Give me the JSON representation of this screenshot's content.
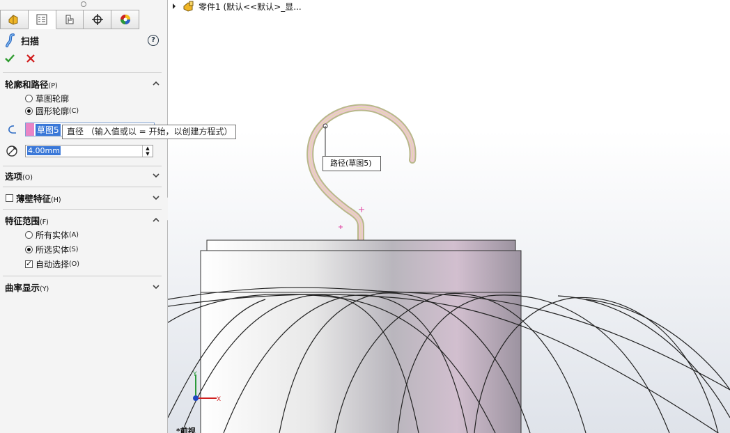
{
  "tabs": [
    {
      "name": "feature-manager-tab"
    },
    {
      "name": "property-manager-tab",
      "active": true
    },
    {
      "name": "configuration-manager-tab"
    },
    {
      "name": "dimxpert-tab"
    },
    {
      "name": "display-manager-tab"
    }
  ],
  "feature": {
    "title": "扫描",
    "help": "?"
  },
  "sections": {
    "profile_path": {
      "title": "轮廓和路径",
      "key": "(P)"
    },
    "options": {
      "title": "选项",
      "key": "(O)"
    },
    "thin": {
      "title": "薄壁特征",
      "key": "(H)"
    },
    "scope": {
      "title": "特征范围",
      "key": "(F)"
    },
    "curvature": {
      "title": "曲率显示",
      "key": "(Y)"
    }
  },
  "profile_options": {
    "sketch": "草图轮廓",
    "circle": "圆形轮廓",
    "circle_key": "(C)"
  },
  "path_selection": "草图5",
  "tooltip": "直径 （输入值或以 = 开始，以创建方程式）",
  "diameter_value": "4.00mm",
  "scope_options": {
    "all": "所有实体",
    "all_key": "(A)",
    "selected": "所选实体",
    "selected_key": "(S)",
    "auto": "自动选择",
    "auto_key": "(O)"
  },
  "tree_label": "零件1 (默认<<默认>_显...",
  "path_callout": "路径(草图5)",
  "axes": {
    "x": "X",
    "y": "Y"
  },
  "bottom_label": "*前视",
  "colors": {
    "accent": "#3a78d8",
    "ok": "#2f9b2f",
    "cancel": "#d01818",
    "profile_pink": "#e985c6"
  }
}
